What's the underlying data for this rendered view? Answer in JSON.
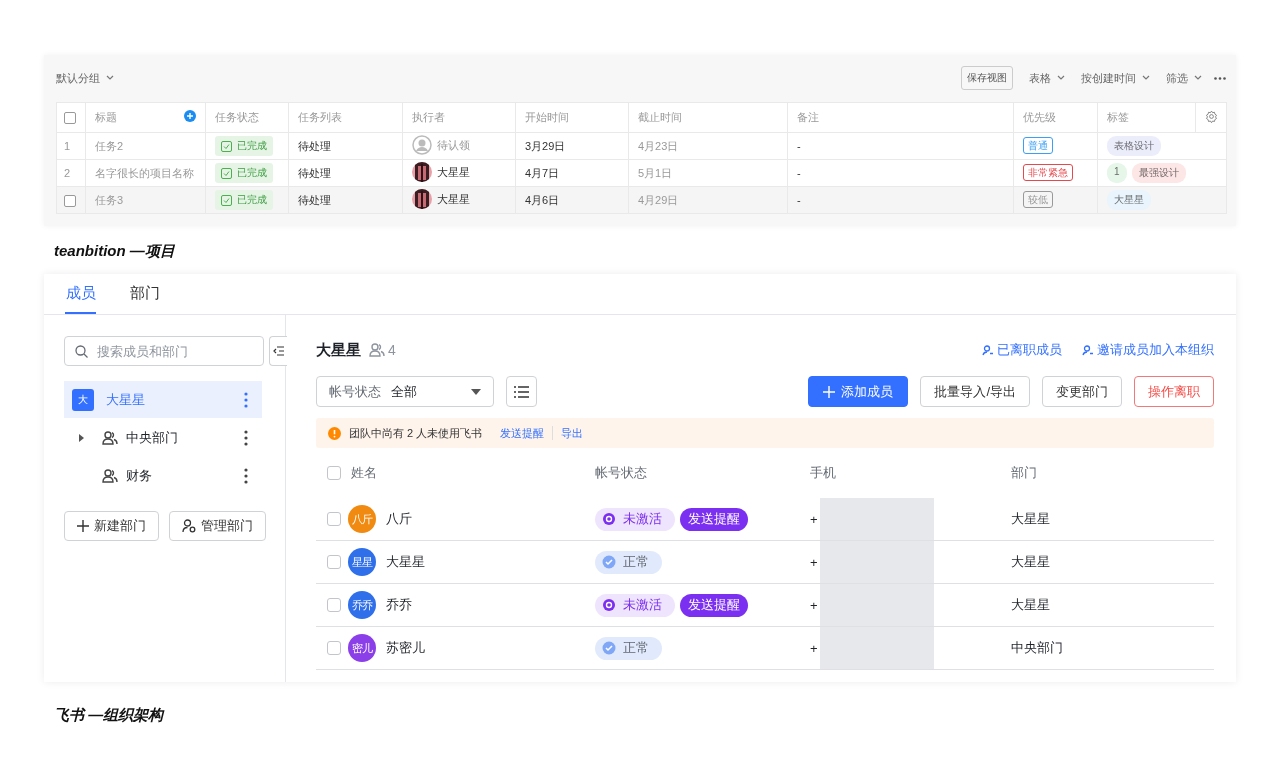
{
  "top": {
    "all_checked": false,
    "group": "默认分组",
    "save_view": "保存视图",
    "view": "表格",
    "sort": "按创建时间",
    "filter": "筛选",
    "columns": [
      "标题",
      "任务状态",
      "任务列表",
      "执行者",
      "开始时间",
      "截止时间",
      "备注",
      "优先级",
      "标签"
    ],
    "rows": [
      {
        "index": "1",
        "selected": false,
        "title": "任务2",
        "status": "已完成",
        "list": "待处理",
        "assignee": {
          "name": "待认领",
          "kind": "unclaimed"
        },
        "start": "3月29日",
        "end": "4月23日",
        "note": "-",
        "priority": {
          "text": "普通",
          "color": "#3c9ff5"
        },
        "tags": [
          {
            "text": "表格设计",
            "color": "#ecedfb"
          }
        ]
      },
      {
        "index": "2",
        "selected": false,
        "title": "名字很长的项目名称",
        "status": "已完成",
        "list": "待处理",
        "assignee": {
          "name": "大星星"
        },
        "start": "4月7日",
        "end": "5月1日",
        "note": "-",
        "priority": {
          "text": "非常紧急",
          "color": "#e5484d"
        },
        "tags": [
          {
            "text": "1",
            "color": "#e6f6e8"
          },
          {
            "text": "最强设计",
            "color": "#fde6e6"
          }
        ]
      },
      {
        "selected": true,
        "checked": false,
        "title": "任务3",
        "status": "已完成",
        "list": "待处理",
        "assignee": {
          "name": "大星星"
        },
        "start": "4月6日",
        "end": "4月29日",
        "note": "-",
        "priority": {
          "text": "较低",
          "color": "#999999"
        },
        "tags": [
          {
            "text": "大星星",
            "color": "#eaf4fd"
          }
        ]
      }
    ]
  },
  "caption_top": "teanbition —项目",
  "org": {
    "tabs": [
      {
        "label": "成员",
        "selected": true
      },
      {
        "label": "部门",
        "selected": false
      }
    ],
    "search": {
      "placeholder": "搜索成员和部门"
    },
    "tree": [
      {
        "label": "大星星",
        "kind": "org",
        "badge": "大",
        "selected": true
      },
      {
        "label": "中央部门",
        "kind": "group",
        "selected": false
      },
      {
        "label": "财务",
        "kind": "dept",
        "selected": false
      }
    ],
    "tree_buttons": [
      {
        "label": "新建部门",
        "kind": "add"
      },
      {
        "label": "管理部门",
        "kind": "manage"
      }
    ],
    "title": "大星星",
    "member_count": "4",
    "links": [
      "已离职成员",
      "邀请成员加入本组织"
    ],
    "filter": {
      "label": "帐号状态",
      "value": "全部"
    },
    "actions": [
      {
        "label": "添加成员",
        "kind": "primary"
      },
      {
        "label": "批量导入/导出",
        "kind": "default"
      },
      {
        "label": "变更部门",
        "kind": "default"
      },
      {
        "label": "操作离职",
        "kind": "danger"
      }
    ],
    "notice": {
      "text": "团队中尚有 2 人未使用飞书",
      "links": [
        "发送提醒",
        "导出"
      ]
    },
    "all_checked": false,
    "columns": [
      "姓名",
      "帐号状态",
      "手机",
      "部门"
    ],
    "members": [
      {
        "checked": false,
        "avatar": "八斤",
        "color": "#f08a10",
        "name": "八斤",
        "status": {
          "kind": "inactive",
          "text": "未激活"
        },
        "remind": "发送提醒",
        "phone": "+",
        "dept": "大星星"
      },
      {
        "checked": false,
        "avatar": "星星",
        "color": "#2f6fea",
        "name": "大星星",
        "status": {
          "kind": "active",
          "text": "正常"
        },
        "phone": "+",
        "dept": "大星星"
      },
      {
        "checked": false,
        "avatar": "乔乔",
        "color": "#2f6fea",
        "name": "乔乔",
        "status": {
          "kind": "inactive",
          "text": "未激活"
        },
        "remind": "发送提醒",
        "phone": "+",
        "dept": "大星星"
      },
      {
        "checked": false,
        "avatar": "密儿",
        "color": "#8a3fe8",
        "name": "苏密儿",
        "status": {
          "kind": "active",
          "text": "正常"
        },
        "phone": "+",
        "dept": "中央部门"
      }
    ]
  },
  "caption_bottom": "飞书 —组织架构"
}
